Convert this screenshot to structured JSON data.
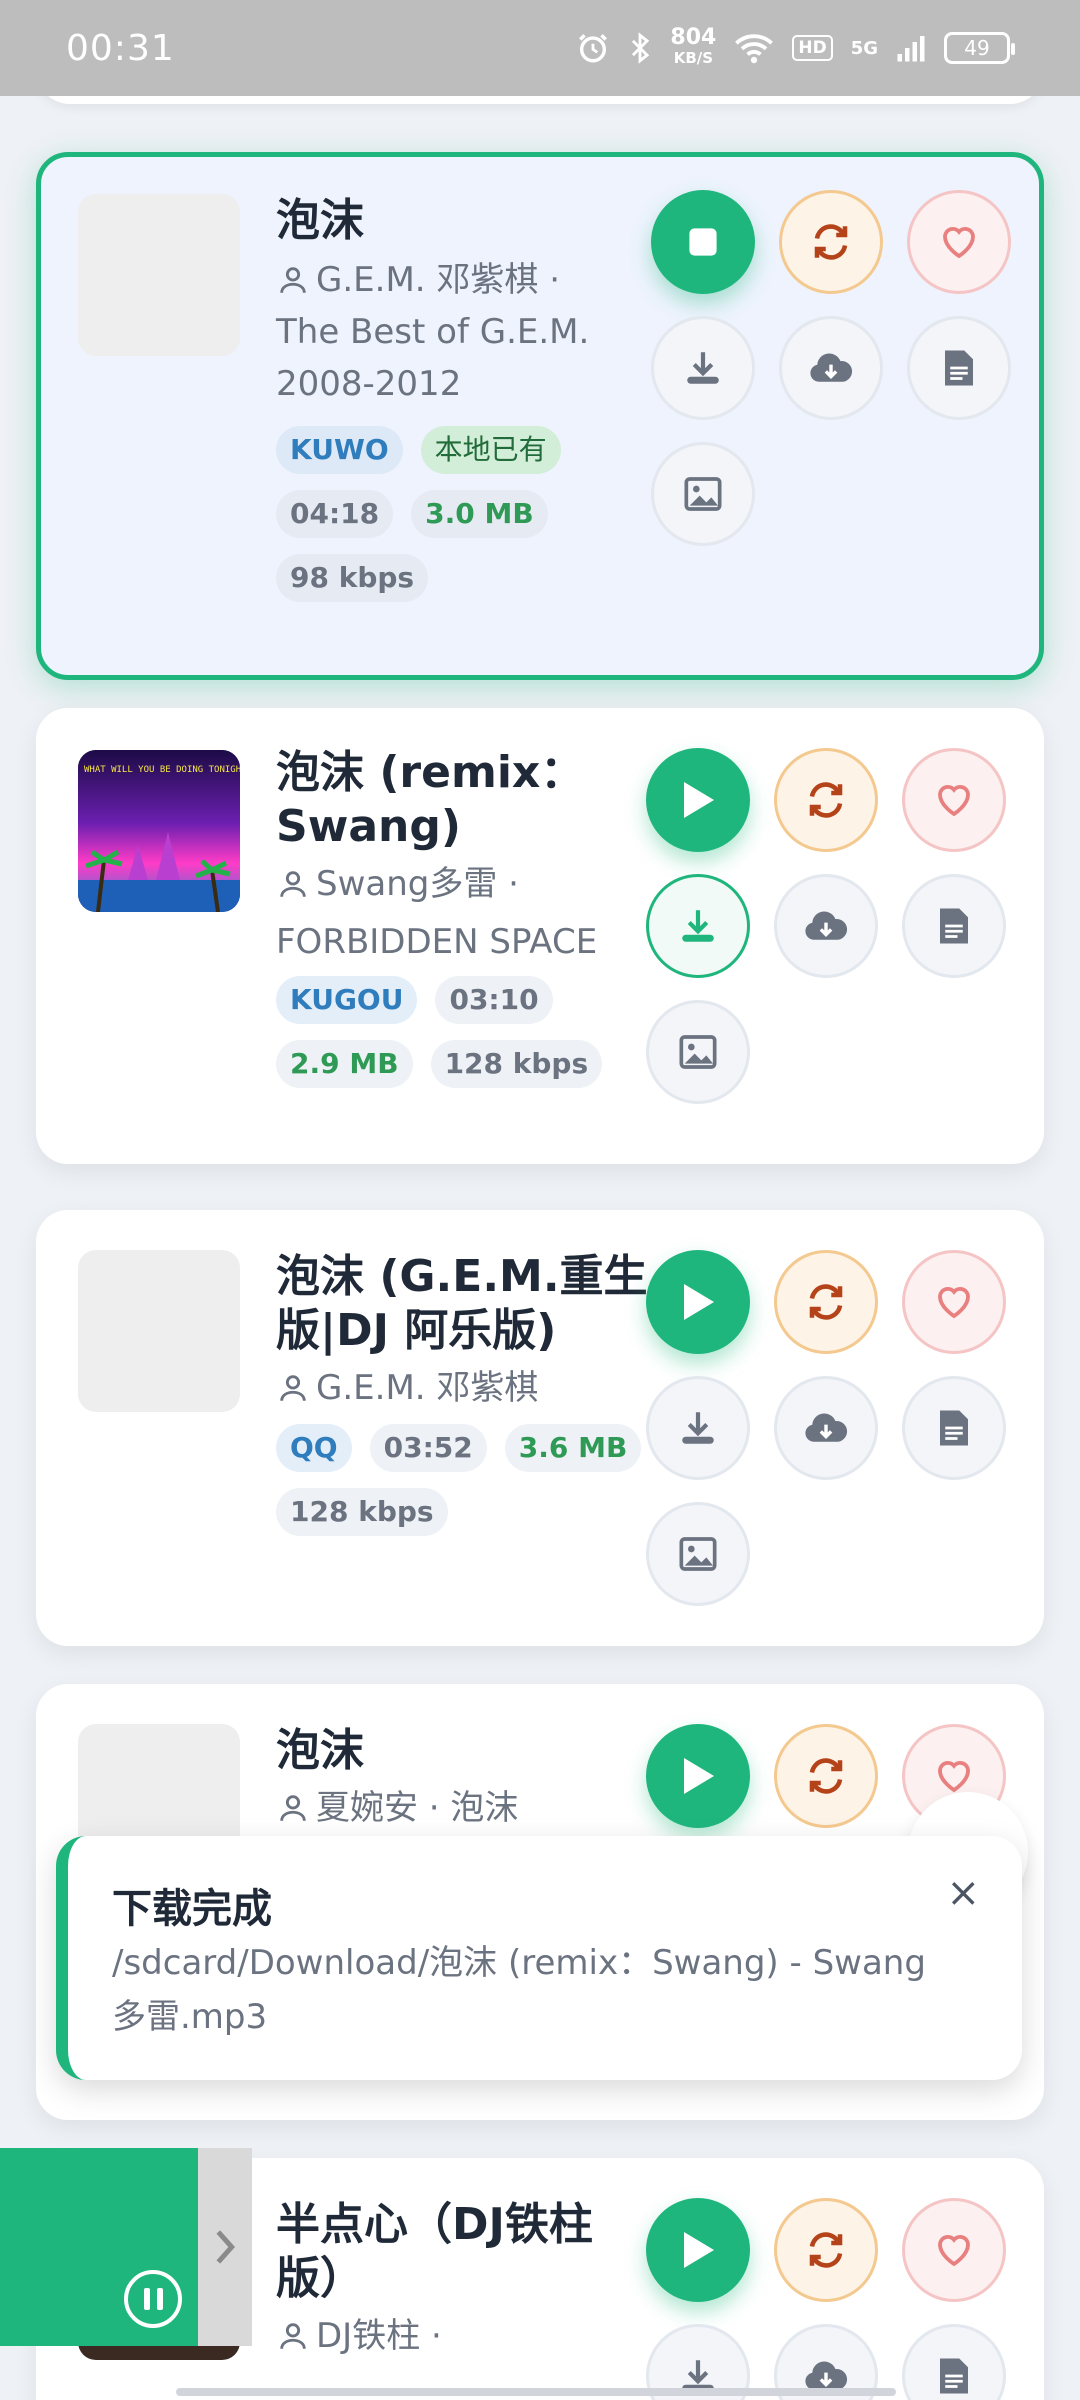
{
  "status_bar": {
    "time": "00:31",
    "net_speed_value": "804",
    "net_speed_unit": "KB/S",
    "hd": "HD",
    "signal": "5G",
    "battery": "49"
  },
  "songs": [
    {
      "title": "泡沫",
      "artist": "G.E.M. 邓紫棋 ·",
      "album": "The Best of G.E.M. 2008-2012",
      "source": "KUWO",
      "local_tag": "本地已有",
      "duration": "04:18",
      "size": "3.0 MB",
      "bitrate": "98 kbps"
    },
    {
      "title": "泡沫 (remix：Swang)",
      "artist": "Swang多雷 ·",
      "album": "FORBIDDEN SPACE",
      "source": "KUGOU",
      "duration": "03:10",
      "size": "2.9 MB",
      "bitrate": "128 kbps"
    },
    {
      "title": "泡沫 (G.E.M.重生版|DJ 阿乐版)",
      "artist": "G.E.M. 邓紫棋",
      "source": "QQ",
      "duration": "03:52",
      "size": "3.6 MB",
      "bitrate": "128 kbps"
    },
    {
      "title": "泡沫",
      "artist": "夏婉安 · 泡沫"
    },
    {
      "title": "半点心（DJ铁柱版）",
      "artist": "DJ铁柱 ·"
    }
  ],
  "cover_art_text": "WHAT WILL YOU BE DOING TONIGHT ?",
  "toast": {
    "title": "下载完成",
    "message": "/sdcard/Download/泡沫 (remix：Swang) - Swang多雷.mp3",
    "close": "×"
  },
  "icons": {
    "play": "play-icon",
    "stop": "stop-icon",
    "refresh": "refresh-icon",
    "favorite": "heart-icon",
    "download": "download-icon",
    "cloud": "cloud-download-icon",
    "lyrics": "document-icon",
    "cover": "image-icon",
    "pause": "pause-icon",
    "chevron": "chevron-right-icon"
  },
  "colors": {
    "accent": "#1fb67d",
    "source_tag": "#2f7dbd",
    "size_tag": "#2f9a55",
    "refresh": "#b5431a",
    "favorite": "#e98080"
  }
}
